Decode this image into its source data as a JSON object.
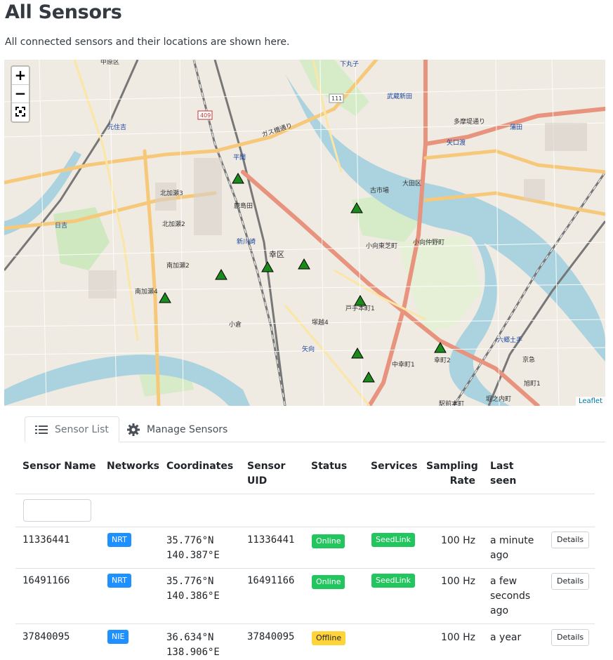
{
  "page": {
    "title": "All Sensors",
    "description": "All connected sensors and their locations are shown here."
  },
  "map": {
    "zoom_in": "+",
    "zoom_out": "−",
    "attribution": "Leaflet",
    "labels": [
      "中原区",
      "下丸子",
      "武蔵新田",
      "多摩堤通り",
      "蒲田",
      "矢口渡",
      "元住吉",
      "平間",
      "鹿島田",
      "新川崎",
      "古市場",
      "大田区",
      "小向東芝町",
      "小向仲野町",
      "戸手本町1",
      "幸区",
      "小倉",
      "塚越4",
      "矢向",
      "中幸町1",
      "幸町",
      "南加瀬2",
      "南加瀬4",
      "北加瀬2",
      "北加瀬3",
      "日吉",
      "六郷土手",
      "京急",
      "旭町1",
      "堀之内町",
      "駅前本町",
      "ガス橋通り",
      "409",
      "111"
    ]
  },
  "tabs": [
    {
      "label": "Sensor List",
      "icon": "list-icon",
      "active": true
    },
    {
      "label": "Manage Sensors",
      "icon": "gear-icon",
      "active": false
    }
  ],
  "table": {
    "headers": {
      "name": "Sensor Name",
      "networks": "Networks",
      "coordinates": "Coordinates",
      "uid_1": "Sensor",
      "uid_2": "UID",
      "status": "Status",
      "services": "Services",
      "rate_1": "Sampling",
      "rate_2": "Rate",
      "seen_1": "Last",
      "seen_2": "seen"
    },
    "filter_placeholder": "",
    "details_label": "Details",
    "rows": [
      {
        "name": "11336441",
        "network": "NRT",
        "lat": "35.776°N",
        "lon": "140.387°E",
        "uid": "11336441",
        "status": "Online",
        "service": "SeedLink",
        "rate": "100 Hz",
        "seen_1": "a minute",
        "seen_2": "ago",
        "seen_3": ""
      },
      {
        "name": "16491166",
        "network": "NRT",
        "lat": "35.776°N",
        "lon": "140.386°E",
        "uid": "16491166",
        "status": "Online",
        "service": "SeedLink",
        "rate": "100 Hz",
        "seen_1": "a few",
        "seen_2": "seconds",
        "seen_3": "ago"
      },
      {
        "name": "37840095",
        "network": "NIE",
        "lat": "36.634°N",
        "lon": "138.906°E",
        "uid": "37840095",
        "status": "Offline",
        "service": "",
        "rate": "100 Hz",
        "seen_1": "a year",
        "seen_2": "",
        "seen_3": ""
      }
    ]
  },
  "colors": {
    "network_badge": "#1e90ff",
    "online_badge": "#22c55e",
    "offline_badge": "#ffd43b",
    "marker": "#1a8a1a"
  }
}
